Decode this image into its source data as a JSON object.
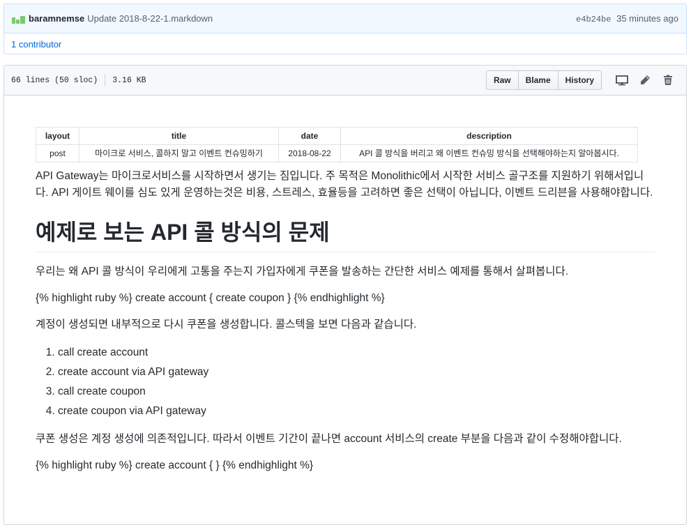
{
  "commit": {
    "author": "baramnemse",
    "message": "Update 2018-8-22-1.markdown",
    "sha": "e4b24be",
    "time": "35 minutes ago",
    "contributors": "1 contributor"
  },
  "file": {
    "lines": "66 lines (50 sloc)",
    "size": "3.16 KB",
    "buttons": {
      "raw": "Raw",
      "blame": "Blame",
      "history": "History"
    },
    "icons": [
      "desktop-icon",
      "pencil-icon",
      "trash-icon"
    ]
  },
  "frontmatter": {
    "headers": [
      "layout",
      "title",
      "date",
      "description"
    ],
    "row": [
      "post",
      "마이크로 서비스, 콜하지 말고 이벤트 컨슈밍하기",
      "2018-08-22",
      "API 콜 방식을 버리고 왜 이벤트 컨슈밍 방식을 선택해야하는지 알아봅시다."
    ]
  },
  "content": {
    "intro": "API Gateway는 마이크로서비스를 시작하면서 생기는 짐입니다. 주 목적은 Monolithic에서 시작한 서비스 골구조를 지원하기 위해서입니다. API 게이트 웨이를 심도 있게 운영하는것은 비용, 스트레스, 효율등을 고려하면 좋은 선택이 아닙니다, 이벤트 드리븐을 사용해야합니다.",
    "heading": "예제로 보는 API 콜 방식의 문제",
    "p1": "우리는 왜 API 콜 방식이 우리에게 고통을 주는지 가입자에게 쿠폰을 발송하는 간단한 서비스 예제를 통해서 살펴봅니다.",
    "code1": "{% highlight ruby %} create account { create coupon } {% endhighlight %}",
    "p2": "계정이 생성되면 내부적으로 다시 쿠폰을 생성합니다. 콜스텍을 보면 다음과 같습니다.",
    "steps": [
      "call create account",
      "create account via API gateway",
      "call create coupon",
      "create coupon via API gateway"
    ],
    "p3": "쿠폰 생성은 계정 생성에 의존적입니다. 따라서 이벤트 기간이 끝나면 account 서비스의 create 부분을 다음과 같이 수정해야합니다.",
    "code2": "{% highlight ruby %} create account { } {% endhighlight %}"
  },
  "colors": {
    "link": "#0366d6",
    "commit_bg": "#f1f8ff",
    "header_bg": "#f6f8fa"
  }
}
